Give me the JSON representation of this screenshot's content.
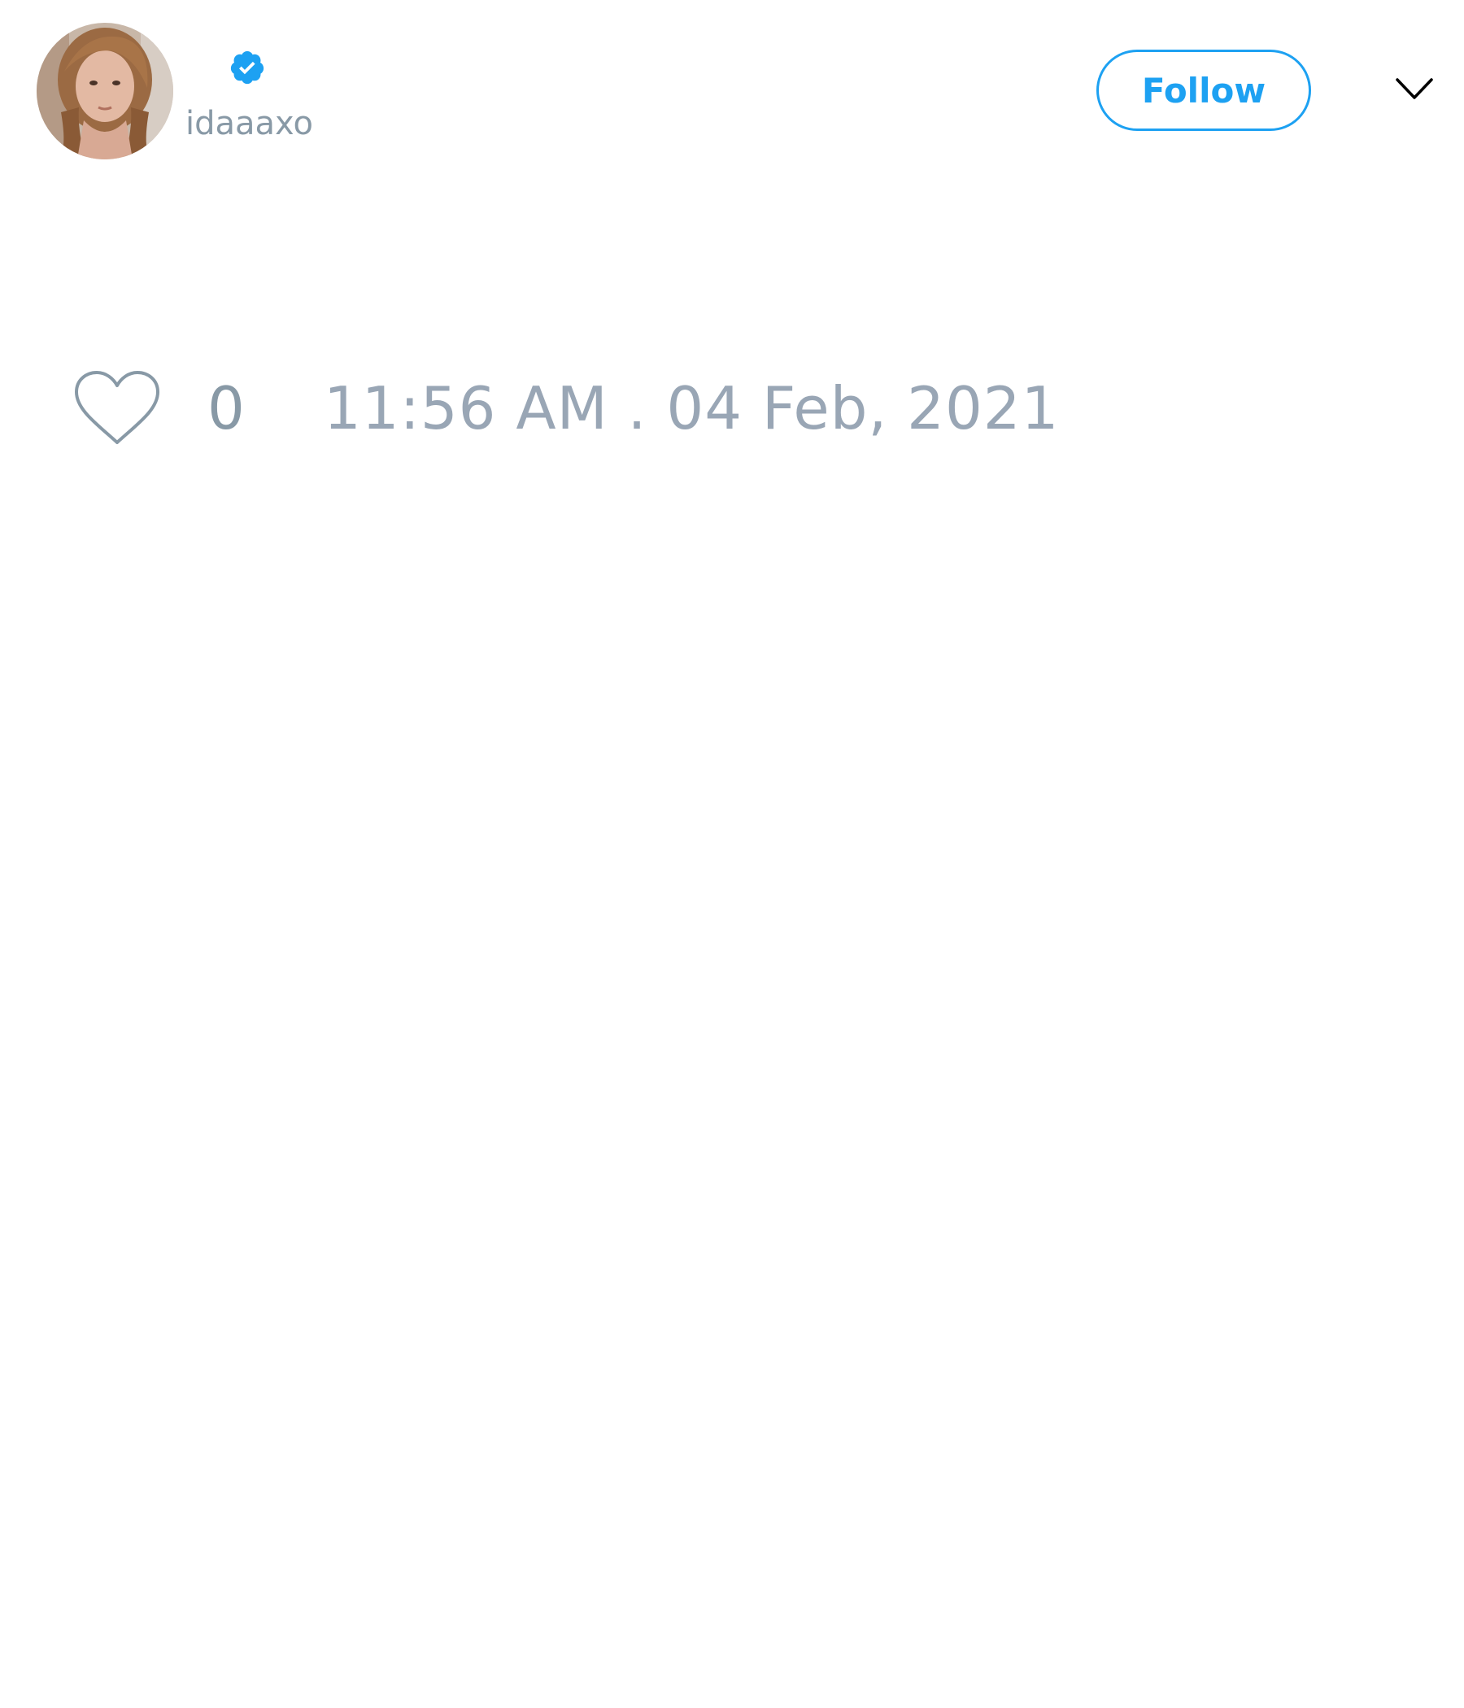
{
  "user": {
    "handle": "idaaaxo",
    "verified": true,
    "avatar_icon": "profile-photo"
  },
  "actions": {
    "follow_label": "Follow",
    "menu_icon": "chevron-down-icon"
  },
  "stats": {
    "like_icon": "heart-outline-icon",
    "like_count": "0",
    "timestamp": "11:56 AM . 04 Feb, 2021"
  },
  "colors": {
    "accent": "#1da1f2",
    "muted_text": "#8899a6",
    "background": "#ffffff"
  }
}
